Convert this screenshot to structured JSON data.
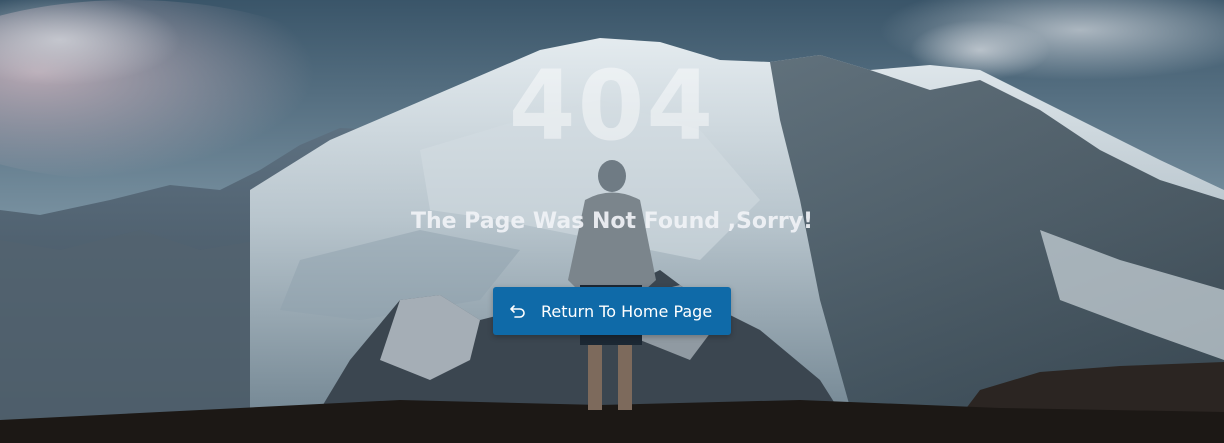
{
  "error": {
    "code": "404",
    "message": "The Page Was Not Found ,Sorry!"
  },
  "actions": {
    "home_label": "Return To Home Page",
    "home_icon": "return-arrow-icon"
  },
  "colors": {
    "button": "#0f6aa8",
    "sky_top": "#2f4a5e",
    "sky_bottom": "#8fa6b4",
    "snow": "#d6dee4",
    "rock": "#2b3b47",
    "ground": "#1a1714"
  }
}
